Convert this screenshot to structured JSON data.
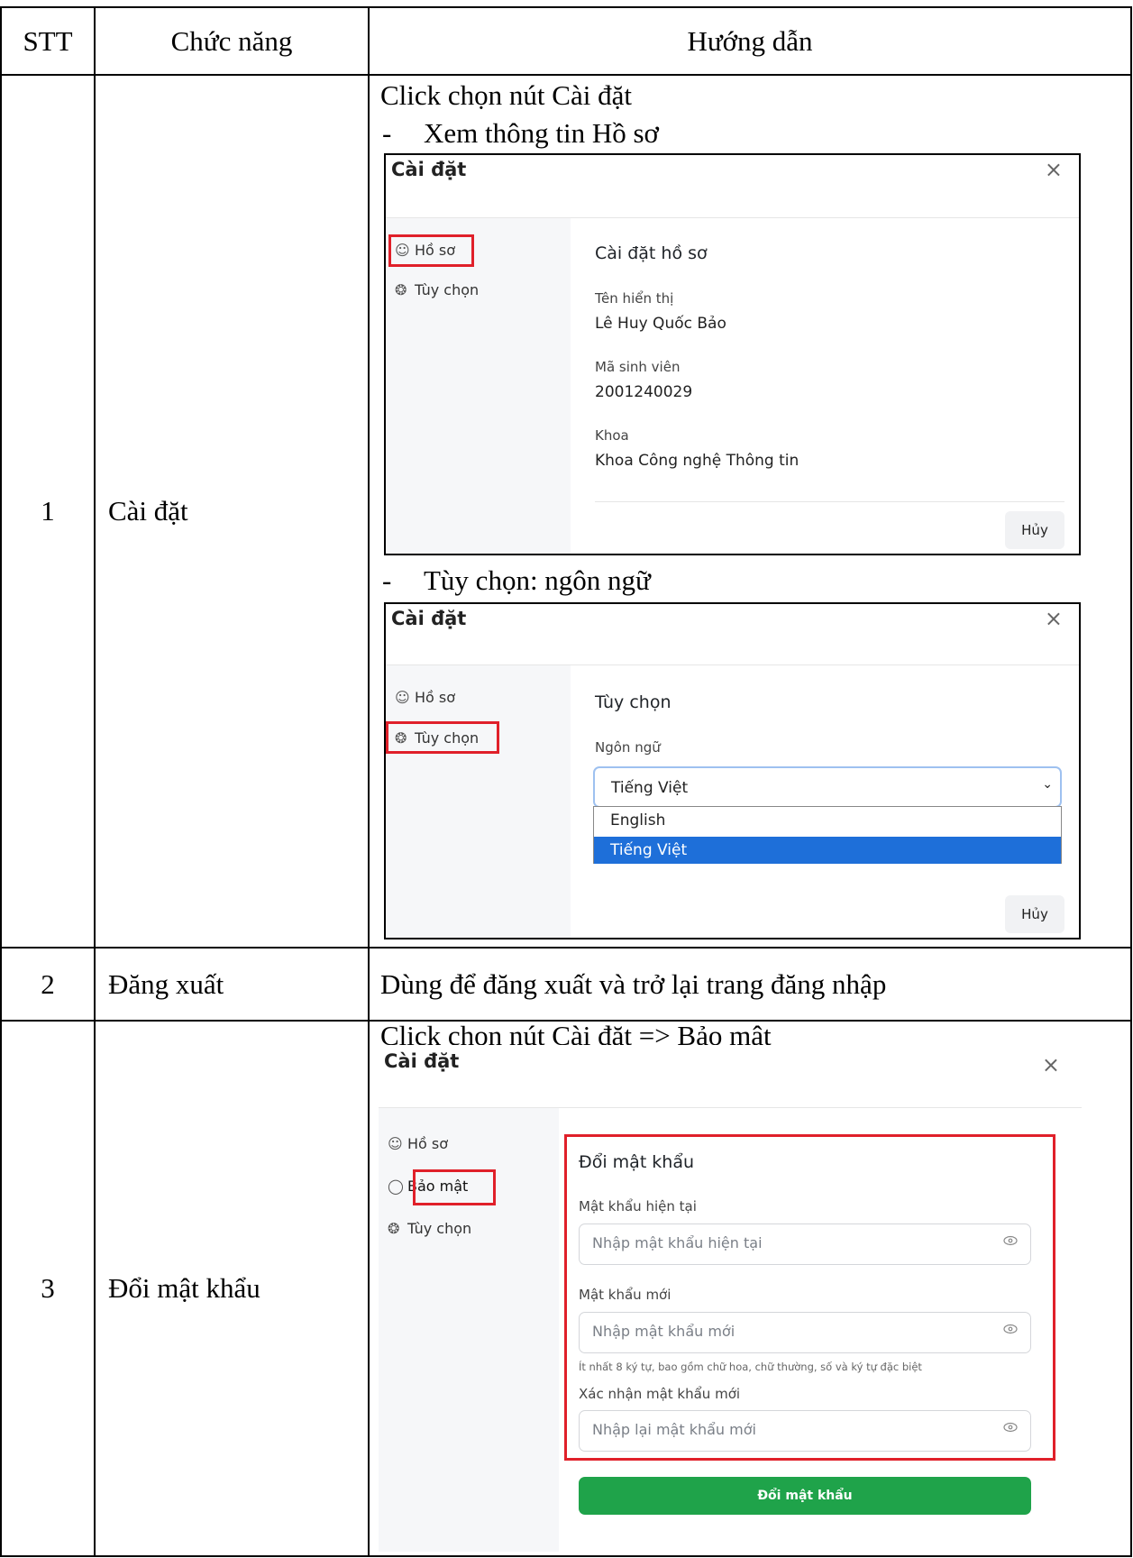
{
  "header": {
    "stt": "STT",
    "function": "Chức năng",
    "guide": "Hướng dẫn"
  },
  "rows": [
    {
      "stt": "1",
      "function": "Cài đặt",
      "intro": "Click chọn nút Cài đặt",
      "bullet1": "Xem thông tin Hồ sơ",
      "bullet2": "Tùy chọn: ngôn ngữ"
    },
    {
      "stt": "2",
      "function": "Đăng xuất",
      "guide": "Dùng để đăng xuất và trở lại trang đăng nhập"
    },
    {
      "stt": "3",
      "function": "Đổi mật khẩu",
      "intro": "Click chọn nút Cài đặt => Bảo mật"
    }
  ],
  "dialog": {
    "title": "Cài đặt",
    "close": "×",
    "nav_profile": "Hồ sơ",
    "nav_security": "Bảo mật",
    "nav_options": "Tùy chọn",
    "cancel": "Hủy"
  },
  "profile": {
    "heading": "Cài đặt hồ sơ",
    "name_label": "Tên hiển thị",
    "name_value": "Lê Huy Quốc Bảo",
    "id_label": "Mã sinh viên",
    "id_value": "2001240029",
    "faculty_label": "Khoa",
    "faculty_value": "Khoa Công nghệ Thông tin"
  },
  "options": {
    "heading": "Tùy chọn",
    "language_label": "Ngôn ngữ",
    "language_selected": "Tiếng Việt",
    "language_options": [
      "English",
      "Tiếng Việt"
    ]
  },
  "password": {
    "heading": "Đổi mật khẩu",
    "current_label": "Mật khẩu hiện tại",
    "current_placeholder": "Nhập mật khẩu hiện tại",
    "new_label": "Mật khẩu mới",
    "new_placeholder": "Nhập mật khẩu mới",
    "hint": "Ít nhất 8 ký tự, bao gồm chữ hoa, chữ thường, số và ký tự đặc biệt",
    "confirm_label": "Xác nhận mật khẩu mới",
    "confirm_placeholder": "Nhập lại mật khẩu mới",
    "submit": "Đổi mật khẩu"
  },
  "colors": {
    "highlight": "#e0202a",
    "primary_green": "#1fa34a",
    "select_blue": "#1e6fd9"
  }
}
